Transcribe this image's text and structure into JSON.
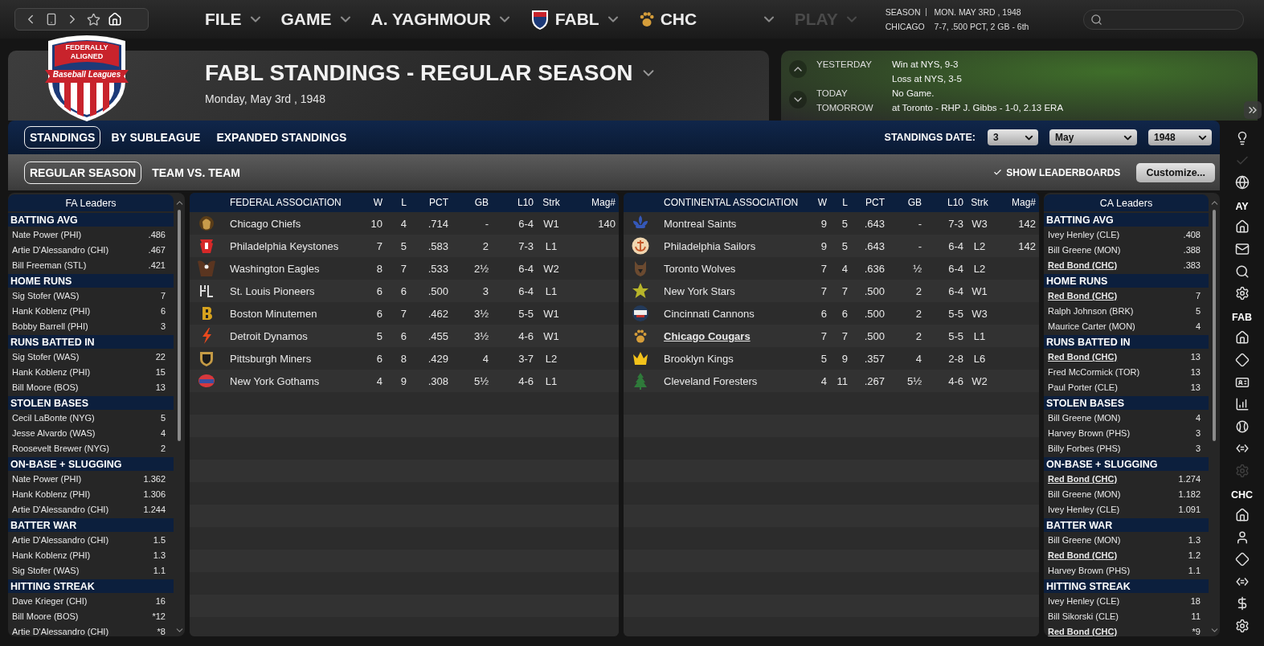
{
  "top_bar": {
    "menus": [
      {
        "label": "FILE",
        "kind": "plain",
        "disabled": false
      },
      {
        "label": "GAME",
        "kind": "plain",
        "disabled": false
      },
      {
        "label": "A. YAGHMOUR",
        "kind": "plain",
        "disabled": false
      },
      {
        "label": "FABL",
        "kind": "league",
        "disabled": false
      },
      {
        "label": "CHC",
        "kind": "team",
        "disabled": false
      },
      {
        "label": "PLAY",
        "kind": "plain",
        "disabled": true
      }
    ],
    "season": {
      "label": "SEASON",
      "date": "MON. MAY 3RD , 1948",
      "team": "CHICAGO",
      "record": "7-7, .500 PCT, 2 GB - 6th"
    }
  },
  "header": {
    "logo": [
      "FEDERALLY",
      "ALIGNED",
      "Baseball Leagues"
    ],
    "title": "FABL STANDINGS - REGULAR SEASON",
    "date": "Monday, May 3rd , 1948"
  },
  "schedule": [
    {
      "label": "YESTERDAY",
      "values": [
        "Win at NYS, 9-3",
        "Loss at NYS, 3-5"
      ]
    },
    {
      "label": "TODAY",
      "values": [
        "No Game."
      ]
    },
    {
      "label": "TOMORROW",
      "values": [
        "at Toronto - RHP J. Gibbs - 1-0, 2.13 ERA"
      ]
    }
  ],
  "tabs": [
    {
      "label": "STANDINGS",
      "selected": true
    },
    {
      "label": "BY SUBLEAGUE",
      "selected": false
    },
    {
      "label": "EXPANDED STANDINGS",
      "selected": false
    }
  ],
  "standings_date": {
    "label": "STANDINGS DATE:",
    "day": "3",
    "month": "May",
    "year": "1948"
  },
  "sub_tabs": [
    {
      "label": "REGULAR SEASON",
      "selected": true
    },
    {
      "label": "TEAM VS. TEAM",
      "selected": false
    }
  ],
  "show_leaderboards": {
    "label": "SHOW LEADERBOARDS",
    "checked": true
  },
  "customize": "Customize...",
  "leaders": [
    {
      "title": "FA Leaders",
      "sections": [
        {
          "title": "BATTING AVG",
          "entries": [
            {
              "name": "Nate Power (PHI)",
              "value": ".486",
              "own_team": false
            },
            {
              "name": "Artie D'Alessandro (CHI)",
              "value": ".467",
              "own_team": false
            },
            {
              "name": "Bill Freeman (STL)",
              "value": ".421",
              "own_team": false
            }
          ]
        },
        {
          "title": "HOME RUNS",
          "entries": [
            {
              "name": "Sig Stofer (WAS)",
              "value": "7",
              "own_team": false
            },
            {
              "name": "Hank Koblenz (PHI)",
              "value": "6",
              "own_team": false
            },
            {
              "name": "Bobby Barrell (PHI)",
              "value": "3",
              "own_team": false
            }
          ]
        },
        {
          "title": "RUNS BATTED IN",
          "entries": [
            {
              "name": "Sig Stofer (WAS)",
              "value": "22",
              "own_team": false
            },
            {
              "name": "Hank Koblenz (PHI)",
              "value": "15",
              "own_team": false
            },
            {
              "name": "Bill Moore (BOS)",
              "value": "13",
              "own_team": false
            }
          ]
        },
        {
          "title": "STOLEN BASES",
          "entries": [
            {
              "name": "Cecil LaBonte (NYG)",
              "value": "5",
              "own_team": false
            },
            {
              "name": "Jesse Alvardo (WAS)",
              "value": "4",
              "own_team": false
            },
            {
              "name": "Roosevelt Brewer (NYG)",
              "value": "2",
              "own_team": false
            }
          ]
        },
        {
          "title": "ON-BASE + SLUGGING",
          "entries": [
            {
              "name": "Nate Power (PHI)",
              "value": "1.362",
              "own_team": false
            },
            {
              "name": "Hank Koblenz (PHI)",
              "value": "1.306",
              "own_team": false
            },
            {
              "name": "Artie D'Alessandro (CHI)",
              "value": "1.244",
              "own_team": false
            }
          ]
        },
        {
          "title": "BATTER WAR",
          "entries": [
            {
              "name": "Artie D'Alessandro (CHI)",
              "value": "1.5",
              "own_team": false
            },
            {
              "name": "Hank Koblenz (PHI)",
              "value": "1.3",
              "own_team": false
            },
            {
              "name": "Sig Stofer (WAS)",
              "value": "1.1",
              "own_team": false
            }
          ]
        },
        {
          "title": "HITTING STREAK",
          "entries": [
            {
              "name": "Dave Krieger (CHI)",
              "value": "16",
              "own_team": false
            },
            {
              "name": "Bill Moore (BOS)",
              "value": "*12",
              "own_team": false
            },
            {
              "name": "Artie D'Alessandro (CHI)",
              "value": "*8",
              "own_team": false
            }
          ]
        }
      ]
    },
    {
      "title": "CA Leaders",
      "sections": [
        {
          "title": "BATTING AVG",
          "entries": [
            {
              "name": "Ivey Henley (CLE)",
              "value": ".408",
              "own_team": false
            },
            {
              "name": "Bill Greene (MON)",
              "value": ".388",
              "own_team": false
            },
            {
              "name": "Red Bond (CHC)",
              "value": ".383",
              "own_team": true
            }
          ]
        },
        {
          "title": "HOME RUNS",
          "entries": [
            {
              "name": "Red Bond (CHC)",
              "value": "7",
              "own_team": true
            },
            {
              "name": "Ralph Johnson (BRK)",
              "value": "5",
              "own_team": false
            },
            {
              "name": "Maurice Carter (MON)",
              "value": "4",
              "own_team": false
            }
          ]
        },
        {
          "title": "RUNS BATTED IN",
          "entries": [
            {
              "name": "Red Bond (CHC)",
              "value": "13",
              "own_team": true
            },
            {
              "name": "Fred McCormick (TOR)",
              "value": "13",
              "own_team": false
            },
            {
              "name": "Paul Porter (CLE)",
              "value": "13",
              "own_team": false
            }
          ]
        },
        {
          "title": "STOLEN BASES",
          "entries": [
            {
              "name": "Bill Greene (MON)",
              "value": "4",
              "own_team": false
            },
            {
              "name": "Harvey Brown (PHS)",
              "value": "3",
              "own_team": false
            },
            {
              "name": "Billy Forbes (PHS)",
              "value": "3",
              "own_team": false
            }
          ]
        },
        {
          "title": "ON-BASE + SLUGGING",
          "entries": [
            {
              "name": "Red Bond (CHC)",
              "value": "1.274",
              "own_team": true
            },
            {
              "name": "Bill Greene (MON)",
              "value": "1.182",
              "own_team": false
            },
            {
              "name": "Ivey Henley (CLE)",
              "value": "1.091",
              "own_team": false
            }
          ]
        },
        {
          "title": "BATTER WAR",
          "entries": [
            {
              "name": "Bill Greene (MON)",
              "value": "1.3",
              "own_team": false
            },
            {
              "name": "Red Bond (CHC)",
              "value": "1.2",
              "own_team": true
            },
            {
              "name": "Harvey Brown (PHS)",
              "value": "1.1",
              "own_team": false
            }
          ]
        },
        {
          "title": "HITTING STREAK",
          "entries": [
            {
              "name": "Ivey Henley (CLE)",
              "value": "18",
              "own_team": false
            },
            {
              "name": "Bill Sikorski (CLE)",
              "value": "11",
              "own_team": false
            },
            {
              "name": "Red Bond (CHC)",
              "value": "*9",
              "own_team": true
            }
          ]
        }
      ]
    }
  ],
  "standings": [
    {
      "title": "FEDERAL ASSOCIATION",
      "columns": [
        "W",
        "L",
        "PCT",
        "GB",
        "L10",
        "Strk",
        "Mag#"
      ],
      "rows": [
        {
          "team": "Chicago Chiefs",
          "cells": [
            "10",
            "4",
            ".714",
            "-",
            "6-4",
            "W1",
            "140"
          ],
          "own_team": false
        },
        {
          "team": "Philadelphia Keystones",
          "cells": [
            "7",
            "5",
            ".583",
            "2",
            "7-3",
            "L1"
          ],
          "own_team": false
        },
        {
          "team": "Washington Eagles",
          "cells": [
            "8",
            "7",
            ".533",
            "2½",
            "6-4",
            "W2"
          ],
          "own_team": false
        },
        {
          "team": "St. Louis Pioneers",
          "cells": [
            "6",
            "6",
            ".500",
            "3",
            "6-4",
            "L1"
          ],
          "own_team": false
        },
        {
          "team": "Boston Minutemen",
          "cells": [
            "6",
            "7",
            ".462",
            "3½",
            "5-5",
            "W1"
          ],
          "own_team": false
        },
        {
          "team": "Detroit Dynamos",
          "cells": [
            "5",
            "6",
            ".455",
            "3½",
            "4-6",
            "W1"
          ],
          "own_team": false
        },
        {
          "team": "Pittsburgh Miners",
          "cells": [
            "6",
            "8",
            ".429",
            "4",
            "3-7",
            "L2"
          ],
          "own_team": false
        },
        {
          "team": "New York Gothams",
          "cells": [
            "4",
            "9",
            ".308",
            "5½",
            "4-6",
            "L1"
          ],
          "own_team": false
        }
      ]
    },
    {
      "title": "CONTINENTAL ASSOCIATION",
      "columns": [
        "W",
        "L",
        "PCT",
        "GB",
        "L10",
        "Strk",
        "Mag#"
      ],
      "rows": [
        {
          "team": "Montreal Saints",
          "cells": [
            "9",
            "5",
            ".643",
            "-",
            "7-3",
            "W3",
            "142"
          ],
          "own_team": false
        },
        {
          "team": "Philadelphia Sailors",
          "cells": [
            "9",
            "5",
            ".643",
            "-",
            "6-4",
            "L2",
            "142"
          ],
          "own_team": false
        },
        {
          "team": "Toronto Wolves",
          "cells": [
            "7",
            "4",
            ".636",
            "½",
            "6-4",
            "L2"
          ],
          "own_team": false
        },
        {
          "team": "New York Stars",
          "cells": [
            "7",
            "7",
            ".500",
            "2",
            "6-4",
            "W1"
          ],
          "own_team": false
        },
        {
          "team": "Cincinnati Cannons",
          "cells": [
            "6",
            "6",
            ".500",
            "2",
            "5-5",
            "W3"
          ],
          "own_team": false
        },
        {
          "team": "Chicago Cougars",
          "cells": [
            "7",
            "7",
            ".500",
            "2",
            "5-5",
            "L1"
          ],
          "own_team": true
        },
        {
          "team": "Brooklyn Kings",
          "cells": [
            "5",
            "9",
            ".357",
            "4",
            "2-8",
            "L6"
          ],
          "own_team": false
        },
        {
          "team": "Cleveland Foresters",
          "cells": [
            "4",
            "11",
            ".267",
            "5½",
            "4-6",
            "W2"
          ],
          "own_team": false
        }
      ]
    }
  ],
  "sidebar": {
    "groups": [
      {
        "items": [
          {
            "disabled": false
          },
          {
            "disabled": true
          },
          {
            "disabled": false
          }
        ]
      },
      {
        "label": "AY",
        "items": [
          {
            "disabled": false
          },
          {
            "disabled": false
          },
          {
            "disabled": false
          },
          {
            "disabled": false
          }
        ]
      },
      {
        "label": "FAB",
        "items": [
          {
            "disabled": false
          },
          {
            "disabled": false
          },
          {
            "disabled": false
          },
          {
            "disabled": false
          },
          {
            "disabled": false
          },
          {
            "disabled": false
          },
          {
            "disabled": true
          }
        ]
      },
      {
        "label": "CHC",
        "items": [
          {
            "disabled": false
          },
          {
            "disabled": false
          },
          {
            "disabled": false
          },
          {
            "disabled": false
          },
          {
            "disabled": false
          },
          {
            "disabled": false
          }
        ]
      }
    ]
  }
}
